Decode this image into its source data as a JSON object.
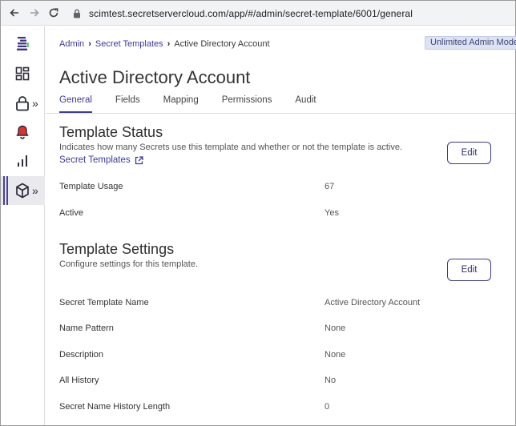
{
  "browser": {
    "url": "scimtest.secretservercloud.com/app/#/admin/secret-template/6001/general"
  },
  "rail": {
    "items": [
      {
        "icon": "logo-icon"
      },
      {
        "icon": "dashboard-icon"
      },
      {
        "icon": "lock-icon",
        "chevron": "»"
      },
      {
        "icon": "bell-icon"
      },
      {
        "icon": "bar-chart-icon"
      },
      {
        "icon": "cube-icon",
        "chevron": "»"
      }
    ],
    "alert_color": "#e0312b",
    "accent": "#4b3fa0"
  },
  "breadcrumb": {
    "admin": "Admin",
    "secret_templates": "Secret Templates",
    "current": "Active Directory Account"
  },
  "mode_badge": "Unlimited Admin Mode",
  "page_title": "Active Directory Account",
  "tabs": [
    {
      "label": "General",
      "active": true
    },
    {
      "label": "Fields"
    },
    {
      "label": "Mapping"
    },
    {
      "label": "Permissions"
    },
    {
      "label": "Audit"
    }
  ],
  "status": {
    "title": "Template Status",
    "description": "Indicates how many Secrets use this template and whether or not the template is active.",
    "link": "Secret Templates",
    "edit_label": "Edit",
    "rows": [
      {
        "label": "Template Usage",
        "value": "67"
      },
      {
        "label": "Active",
        "value": "Yes"
      }
    ]
  },
  "settings": {
    "title": "Template Settings",
    "description": "Configure settings for this template.",
    "edit_label": "Edit",
    "rows": [
      {
        "label": "Secret Template Name",
        "value": "Active Directory Account"
      },
      {
        "label": "Name Pattern",
        "value": "None"
      },
      {
        "label": "Description",
        "value": "None"
      },
      {
        "label": "All History",
        "value": "No"
      },
      {
        "label": "Secret Name History Length",
        "value": "0"
      }
    ]
  }
}
